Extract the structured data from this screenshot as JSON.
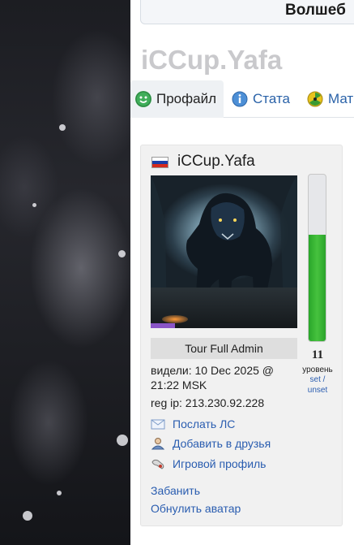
{
  "banner": {
    "text": "Волшеб"
  },
  "page_title": "iCCup.Yafa",
  "tabs": [
    {
      "label": "Профайл",
      "icon": "smiley-icon",
      "active": true
    },
    {
      "label": "Стата",
      "icon": "info-icon",
      "active": false
    },
    {
      "label": "Мат",
      "icon": "radiation-icon",
      "active": false
    }
  ],
  "profile": {
    "country_flag": "russia-flag-icon",
    "nickname": "iCCup.Yafa",
    "avatar": "wolf-avatar-image",
    "role": "Tour Full Admin",
    "seen": "видели: 10 Dec 2025 @ 21:22 MSK",
    "reg_ip": "reg ip: 213.230.92.228",
    "level": {
      "value": "11",
      "label": "уровень",
      "set_label": "set /",
      "unset_label": "unset",
      "progress_percent": 64
    },
    "actions": [
      {
        "label": "Послать ЛС",
        "icon": "envelope-icon"
      },
      {
        "label": "Добавить в друзья",
        "icon": "add-friend-icon"
      },
      {
        "label": "Игровой профиль",
        "icon": "game-profile-icon"
      }
    ],
    "admin_links": {
      "ban": "Забанить",
      "reset_avatar": "Обнулить аватар"
    }
  },
  "colors": {
    "link": "#2a5db0",
    "level_fill": "#3bb534",
    "title_gray": "#c9c9cc"
  }
}
